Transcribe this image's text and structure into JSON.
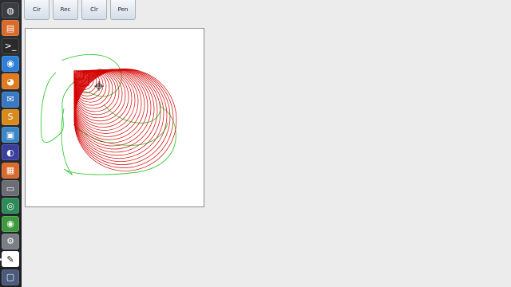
{
  "toolbar": {
    "buttons": [
      {
        "name": "circle-tool-button",
        "label": "Cir"
      },
      {
        "name": "rectangle-tool-button",
        "label": "Rec"
      },
      {
        "name": "clear-button",
        "label": "Clr"
      },
      {
        "name": "pen-tool-button",
        "label": "Pen"
      }
    ]
  },
  "launcher": {
    "items": [
      {
        "name": "dash-home-icon",
        "glyph": "◍",
        "color": "#3b3d42"
      },
      {
        "name": "files-icon",
        "glyph": "▤",
        "color": "#d96b2a"
      },
      {
        "name": "terminal-icon",
        "glyph": ">_",
        "color": "#2a2a2a"
      },
      {
        "name": "chromium-icon",
        "glyph": "◉",
        "color": "#2f7fd6"
      },
      {
        "name": "firefox-icon",
        "glyph": "◕",
        "color": "#e07a1f"
      },
      {
        "name": "thunderbird-icon",
        "glyph": "✉",
        "color": "#3b78c4"
      },
      {
        "name": "sublime-text-icon",
        "glyph": "S",
        "color": "#d98a1c"
      },
      {
        "name": "virtualbox-icon",
        "glyph": "▣",
        "color": "#3a86c8"
      },
      {
        "name": "eclipse-icon",
        "glyph": "◐",
        "color": "#3a3f9e"
      },
      {
        "name": "package-manager-icon",
        "glyph": "▦",
        "color": "#d86a2b"
      },
      {
        "name": "window-manager-icon",
        "glyph": "▭",
        "color": "#6a6d73"
      },
      {
        "name": "system-monitor-icon",
        "glyph": "◎",
        "color": "#2e8b57"
      },
      {
        "name": "chrome-icon",
        "glyph": "◉",
        "color": "#3c9a3c"
      },
      {
        "name": "disk-utility-icon",
        "glyph": "⚙",
        "color": "#7a7f86"
      },
      {
        "name": "paint-app-icon",
        "glyph": "✎",
        "color": "#ffffff"
      },
      {
        "name": "workspace-switcher-icon",
        "glyph": "▢",
        "color": "#4a5a7a"
      }
    ]
  },
  "colors": {
    "circle_stroke": "#d40000",
    "pen_stroke": "#3cc83c",
    "canvas_bg": "#ffffff"
  }
}
